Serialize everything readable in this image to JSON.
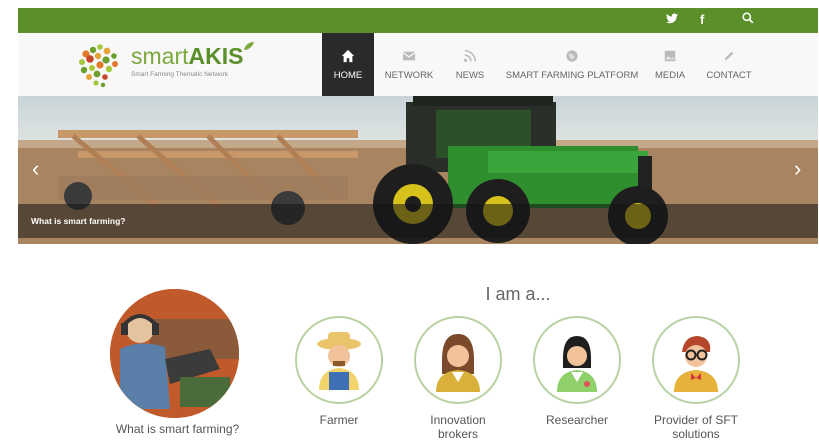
{
  "topbar": {
    "icons": [
      "twitter-icon",
      "facebook-icon",
      "search-icon"
    ],
    "twitter_glyph": "🐦",
    "facebook_glyph": "f"
  },
  "logo": {
    "brand_light": "smart",
    "brand_bold": "AKIS",
    "tagline": "Smart Farming Thematic Network"
  },
  "nav": [
    {
      "label": "HOME",
      "icon": "home-icon",
      "active": true
    },
    {
      "label": "NETWORK",
      "icon": "envelope-icon",
      "active": false
    },
    {
      "label": "NEWS",
      "icon": "rss-icon",
      "active": false
    },
    {
      "label": "SMART FARMING PLATFORM",
      "icon": "globe-icon",
      "active": false
    },
    {
      "label": "MEDIA",
      "icon": "image-icon",
      "active": false
    },
    {
      "label": "CONTACT",
      "icon": "pencil-icon",
      "active": false
    }
  ],
  "hero": {
    "caption": "What is smart farming?",
    "prev_arrow": "‹",
    "next_arrow": "›"
  },
  "feature": {
    "label": "What is smart farming?"
  },
  "personas": {
    "heading": "I am a...",
    "items": [
      {
        "line1": "Farmer",
        "line2": ""
      },
      {
        "line1": "Innovation",
        "line2": "brokers"
      },
      {
        "line1": "Researcher",
        "line2": ""
      },
      {
        "line1": "Provider of SFT",
        "line2": "solutions"
      }
    ]
  },
  "colors": {
    "brand_green": "#5a8f29",
    "nav_active": "#2a2a2a",
    "ring": "#b9d2a2"
  }
}
